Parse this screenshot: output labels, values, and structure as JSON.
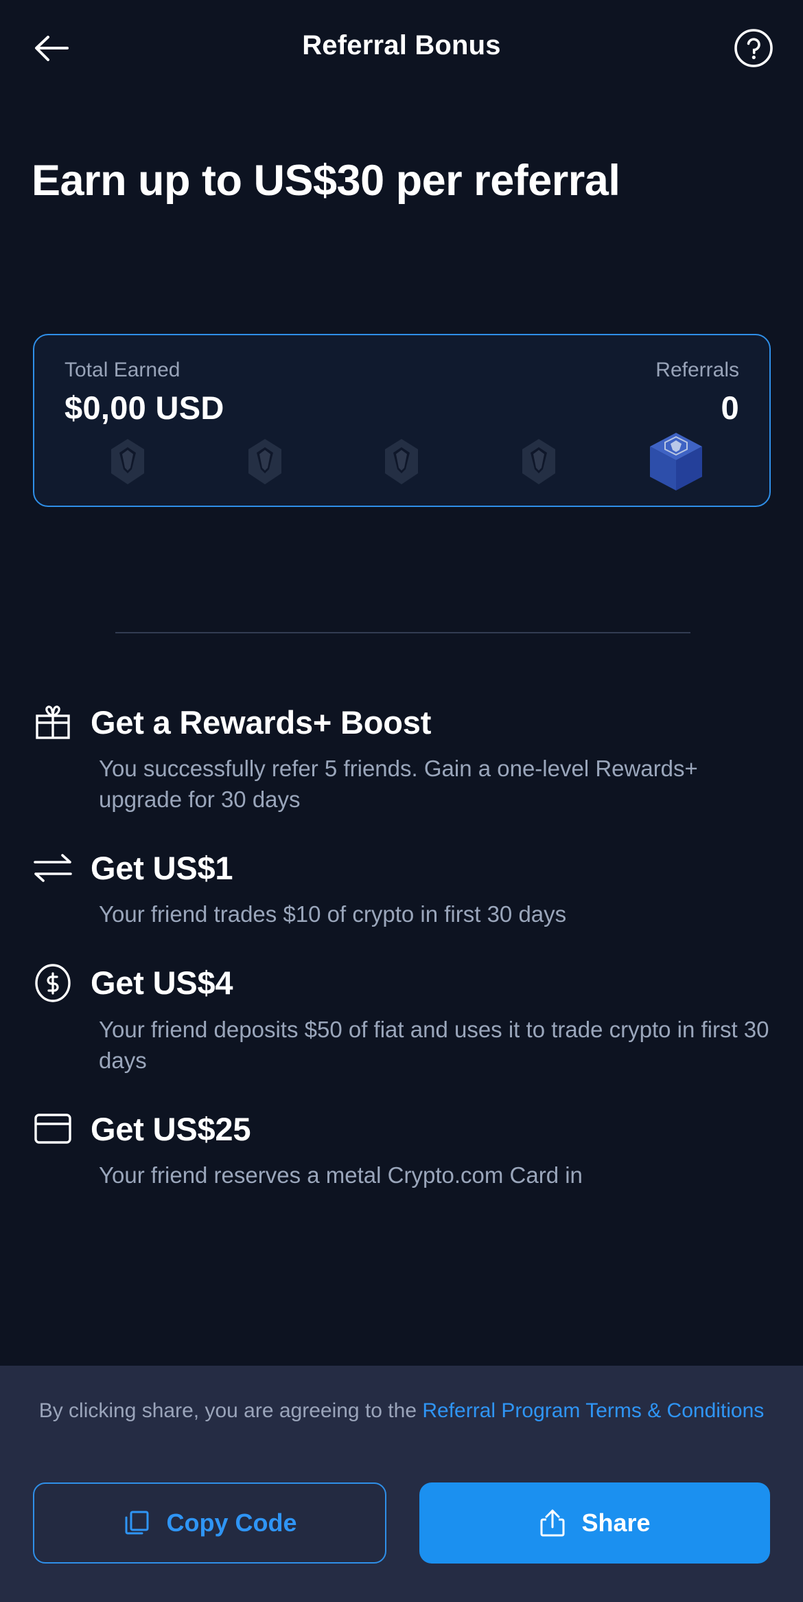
{
  "header": {
    "title": "Referral Bonus",
    "back_icon": "arrow-left-icon",
    "help_icon": "question-circle-icon"
  },
  "hero": {
    "heading": "Earn up to US$30 per referral"
  },
  "stats": {
    "total_earned_label": "Total Earned",
    "total_earned_value": "$0,00 USD",
    "referrals_label": "Referrals",
    "referrals_value": "0",
    "accent_color": "#2f8fe8",
    "progress": [
      {
        "icon": "crypto-com-logo-icon",
        "state": "inactive"
      },
      {
        "icon": "crypto-com-logo-icon",
        "state": "inactive"
      },
      {
        "icon": "crypto-com-logo-icon",
        "state": "inactive"
      },
      {
        "icon": "crypto-com-logo-icon",
        "state": "inactive"
      },
      {
        "icon": "crypto-cube-icon",
        "state": "active"
      }
    ]
  },
  "rewards": [
    {
      "icon": "gift-icon",
      "title": "Get a Rewards+ Boost",
      "desc": "You successfully refer 5 friends. Gain a one-level Rewards+ upgrade for 30 days"
    },
    {
      "icon": "swap-arrows-icon",
      "title": "Get US$1",
      "desc": "Your friend trades $10 of crypto in first 30 days"
    },
    {
      "icon": "dollar-circle-icon",
      "title": "Get US$4",
      "desc": "Your friend deposits $50 of fiat and uses it to trade crypto in first 30 days"
    },
    {
      "icon": "credit-card-icon",
      "title": "Get US$25",
      "desc": "Your friend reserves a metal Crypto.com Card in"
    }
  ],
  "footer": {
    "terms_prefix": "By clicking share, you are agreeing to the ",
    "terms_link": "Referral Program Terms & Conditions",
    "copy_label": "Copy Code",
    "copy_icon": "copy-icon",
    "share_label": "Share",
    "share_icon": "share-upload-icon",
    "link_color": "#2f95f5",
    "share_bg": "#1b90f0"
  }
}
